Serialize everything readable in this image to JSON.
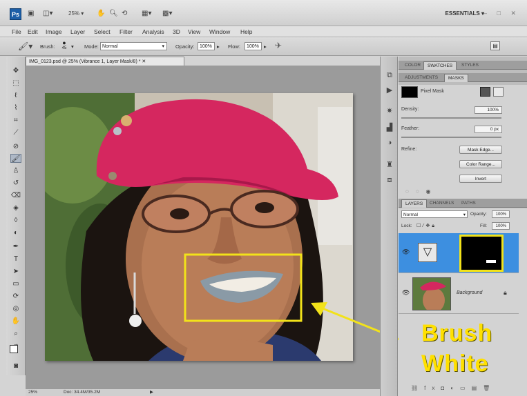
{
  "app": {
    "logo": "Ps",
    "zoom": "25%",
    "workspace": "ESSENTIALS ▾",
    "window_controls": "– □ ✕"
  },
  "menu": [
    "File",
    "Edit",
    "Image",
    "Layer",
    "Select",
    "Filter",
    "Analysis",
    "3D",
    "View",
    "Window",
    "Help"
  ],
  "options": {
    "brush_label": "Brush:",
    "brush_size": "45",
    "mode_label": "Mode:",
    "mode_value": "Normal",
    "opacity_label": "Opacity:",
    "opacity_value": "100%",
    "flow_label": "Flow:",
    "flow_value": "100%"
  },
  "document": {
    "tab_title": "IMG_0123.psd @ 25% (Vibrance 1, Layer Mask/8) * ✕",
    "status_zoom": "25%",
    "status_doc": "Doc: 34.4M/35.2M"
  },
  "panels": {
    "top_tabs": [
      "COLOR",
      "SWATCHES",
      "STYLES"
    ],
    "sub_tabs": [
      "ADJUSTMENTS",
      "MASKS"
    ],
    "mask_title": "Pixel Mask",
    "density_label": "Density:",
    "density_value": "100%",
    "feather_label": "Feather:",
    "feather_value": "0 px",
    "refine_label": "Refine:",
    "mask_edge_btn": "Mask Edge...",
    "color_range_btn": "Color Range...",
    "invert_btn": "Invert"
  },
  "layers": {
    "tabs": [
      "LAYERS",
      "CHANNELS",
      "PATHS"
    ],
    "blend_mode": "Normal",
    "opacity_label": "Opacity:",
    "opacity_value": "100%",
    "lock_label": "Lock:",
    "fill_label": "Fill:",
    "fill_value": "100%",
    "rows": [
      {
        "name": "",
        "type": "adjustment"
      },
      {
        "name": "Background",
        "type": "image"
      }
    ]
  },
  "annotation": {
    "line1": "Brush",
    "line2": "White",
    "color": "#ffe000"
  }
}
